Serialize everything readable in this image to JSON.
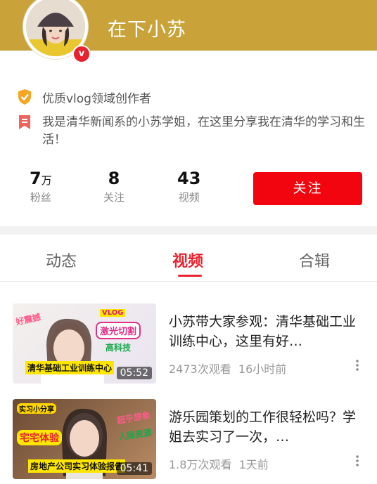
{
  "profile": {
    "name": "在下小苏",
    "verified_badge": "v",
    "creator_tag": "优质vlog领域创作者",
    "bio": "我是清华新闻系的小苏学姐，在这里分享我在清华的学习和生活！",
    "colors": {
      "header_bg": "#c9a33a",
      "accent": "#e8232f"
    }
  },
  "stats": [
    {
      "value": "7",
      "unit": "万",
      "label": "粉丝"
    },
    {
      "value": "8",
      "unit": "",
      "label": "关注"
    },
    {
      "value": "43",
      "unit": "",
      "label": "视频"
    }
  ],
  "follow_button": "关注",
  "tabs": [
    {
      "label": "动态",
      "active": false
    },
    {
      "label": "视频",
      "active": true
    },
    {
      "label": "合辑",
      "active": false
    }
  ],
  "videos": [
    {
      "title": "小苏带大家参观：清华基础工业训练中心，这里有好…",
      "views": "2473次观看",
      "time": "16小时前",
      "duration": "05:52",
      "thumb_texts": [
        "好震撼",
        "VLOG",
        "激光切割",
        "高科技",
        "清华基础工业训练中心"
      ]
    },
    {
      "title": "游乐园策划的工作很轻松吗？学姐去实习了一次，…",
      "views": "1.8万次观看",
      "time": "1天前",
      "duration": "05:41",
      "thumb_texts": [
        "实习小分享",
        "宅宅体验",
        "超乎想象",
        "人脉资源",
        "房地产公司实习体验报告"
      ]
    }
  ]
}
